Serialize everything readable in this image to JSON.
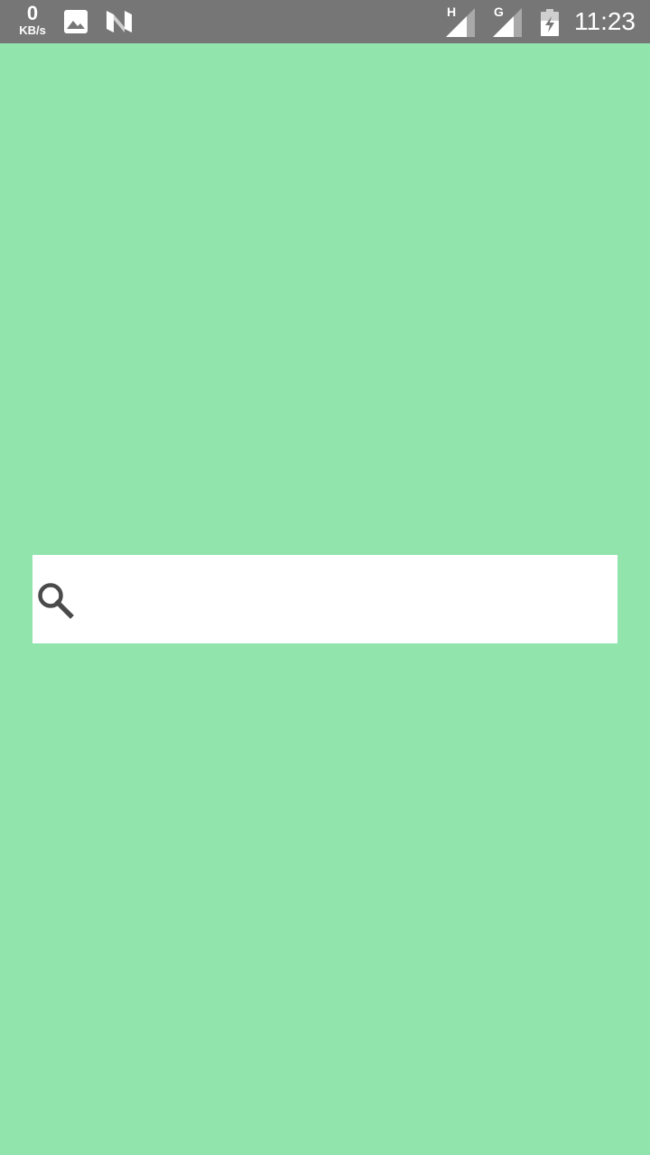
{
  "status_bar": {
    "net_speed_value": "0",
    "net_speed_unit": "KB/s",
    "signal_1_type": "H",
    "signal_2_type": "G",
    "time": "11:23",
    "icons": [
      "image-icon",
      "n-logo-icon",
      "signal-h-icon",
      "signal-g-icon",
      "battery-charging-icon"
    ]
  },
  "colors": {
    "background": "#90e4ac",
    "status_bar": "#767676",
    "search_box": "#ffffff",
    "search_icon": "#4a4a4a"
  },
  "search": {
    "value": "",
    "placeholder": ""
  }
}
